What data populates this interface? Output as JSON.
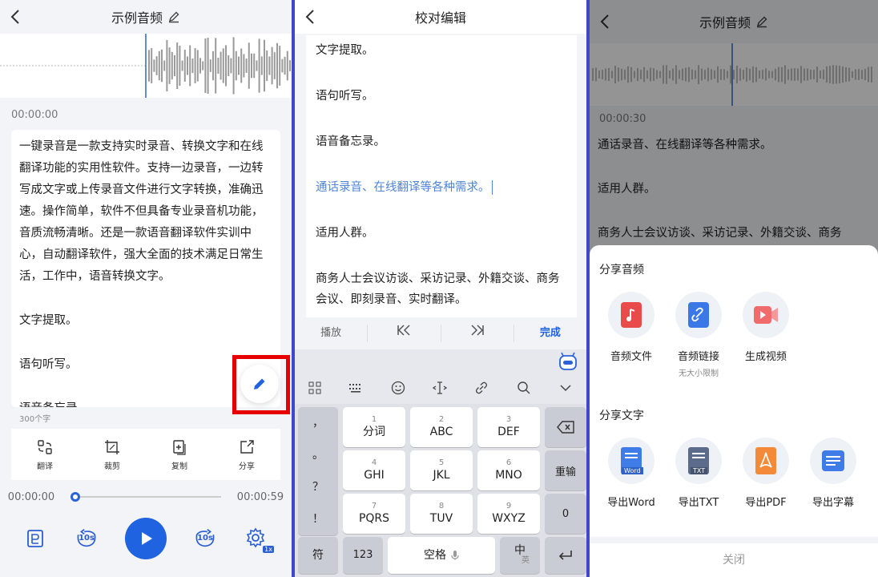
{
  "panel1": {
    "title": "示例音频",
    "time_current": "00:00:00",
    "paragraphs": [
      "一键录音是一款支持实时录音、转换文字和在线翻译功能的实用性软件。支持一边录音，一边转写成文字或上传录音文件进行文字转换，准确迅速。操作简单，软件不但具备专业录音机功能，音质流畅清晰。还是一款语音翻译软件实训中心，自动翻译软件，强大全面的技术满足日常生活，工作中，语音转换文字。",
      "文字提取。",
      "语句听写。",
      "语音备忘录。"
    ],
    "char_count": "300个字",
    "tools": [
      {
        "label": "翻译",
        "icon": "translate-icon"
      },
      {
        "label": "裁剪",
        "icon": "crop-icon"
      },
      {
        "label": "复制",
        "icon": "copy-icon"
      },
      {
        "label": "分享",
        "icon": "share-icon"
      }
    ],
    "progress_start": "00:00:00",
    "progress_end": "00:00:59",
    "progress_fraction": 0.0,
    "skip_back_label": "10s",
    "skip_forward_label": "10s",
    "speed_label": "1x",
    "accent_color": "#1f63e0",
    "highlight_color": "#e60000"
  },
  "panel2": {
    "title": "校对编辑",
    "lines": [
      "文字提取。",
      "语句听写。",
      "语音备忘录。",
      "通话录音、在线翻译等各种需求。",
      "适用人群。",
      "商务人士会议访谈、采访记录、外籍交谈、商务会议、即刻录音、实时翻译。"
    ],
    "highlight_index": 3,
    "highlight_color": "#4f84d6",
    "toolbar": {
      "play": "播放",
      "prev": "|<<",
      "next": ">>|",
      "done": "完成"
    },
    "keyboard": {
      "left_column": [
        "，",
        "。",
        "？",
        "！"
      ],
      "keys": [
        {
          "num": "1",
          "label": "分词"
        },
        {
          "num": "2",
          "label": "ABC"
        },
        {
          "num": "3",
          "label": "DEF"
        },
        {
          "num": "4",
          "label": "GHI"
        },
        {
          "num": "5",
          "label": "JKL"
        },
        {
          "num": "6",
          "label": "MNO"
        },
        {
          "num": "7",
          "label": "PQRS"
        },
        {
          "num": "8",
          "label": "TUV"
        },
        {
          "num": "9",
          "label": "WXYZ"
        }
      ],
      "reenter": "重输",
      "zero": "0",
      "symbol": "符",
      "num_switch": "123",
      "space": "空格",
      "lang_main": "中",
      "lang_sub": "英"
    }
  },
  "panel3": {
    "title": "示例音频",
    "time_current": "00:00:30",
    "paragraphs": [
      "通话录音、在线翻译等各种需求。",
      "适用人群。",
      "商务人士会议访谈、采访记录、外籍交谈、商务"
    ],
    "share_audio_title": "分享音频",
    "audio_items": [
      {
        "label": "音频文件",
        "sub": ""
      },
      {
        "label": "音频链接",
        "sub": "无大小限制"
      },
      {
        "label": "生成视频",
        "sub": ""
      }
    ],
    "share_text_title": "分享文字",
    "text_items": [
      {
        "label": "导出Word",
        "badge": "Word"
      },
      {
        "label": "导出TXT",
        "badge": "TXT"
      },
      {
        "label": "导出PDF",
        "badge": ""
      },
      {
        "label": "导出字幕",
        "badge": ""
      }
    ],
    "close_label": "关闭"
  }
}
